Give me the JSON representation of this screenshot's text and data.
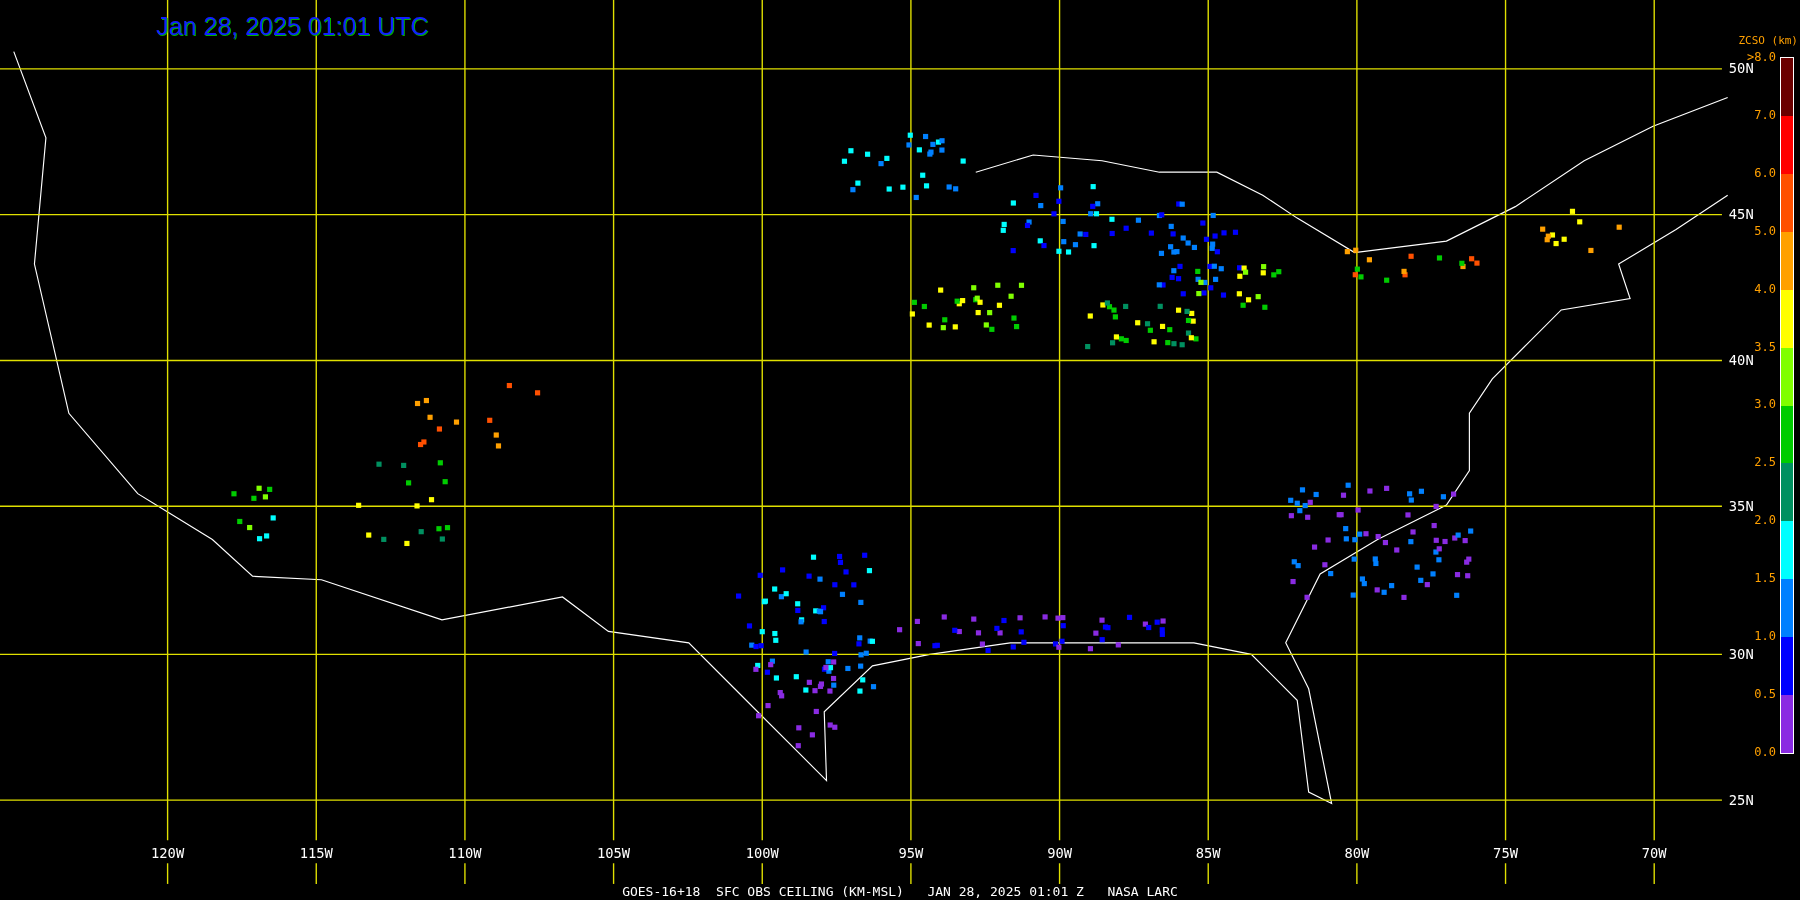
{
  "title": "Jan 28, 2025 01:01 UTC",
  "latitude_labels": [
    "50N",
    "45N",
    "40N",
    "35N",
    "30N",
    "25N"
  ],
  "longitude_labels": [
    "120W",
    "115W",
    "110W",
    "105W",
    "100W",
    "95W",
    "90W",
    "85W",
    "80W",
    "75W",
    "70W"
  ],
  "legend": {
    "title": "ZCSO (km)",
    "labels": [
      ">8.0",
      "7.0",
      "6.0",
      "5.0",
      "4.0",
      "3.5",
      "3.0",
      "2.5",
      "2.0",
      "1.5",
      "1.0",
      "0.5",
      "0.0"
    ],
    "segments": [
      {
        "color": "#6b0000"
      },
      {
        "color": "#ff0000"
      },
      {
        "color": "#ff5000"
      },
      {
        "color": "#ffa000"
      },
      {
        "color": "#ffff00"
      },
      {
        "color": "#80ff00"
      },
      {
        "color": "#00cc00"
      },
      {
        "color": "#009060"
      },
      {
        "color": "#00ffff"
      },
      {
        "color": "#0080ff"
      },
      {
        "color": "#0000ff"
      },
      {
        "color": "#8a2be2"
      }
    ]
  },
  "footer": "GOES-16+18  SFC OBS CEILING (KM-MSL)   JAN 28, 2025 01:01 Z   NASA LARC"
}
